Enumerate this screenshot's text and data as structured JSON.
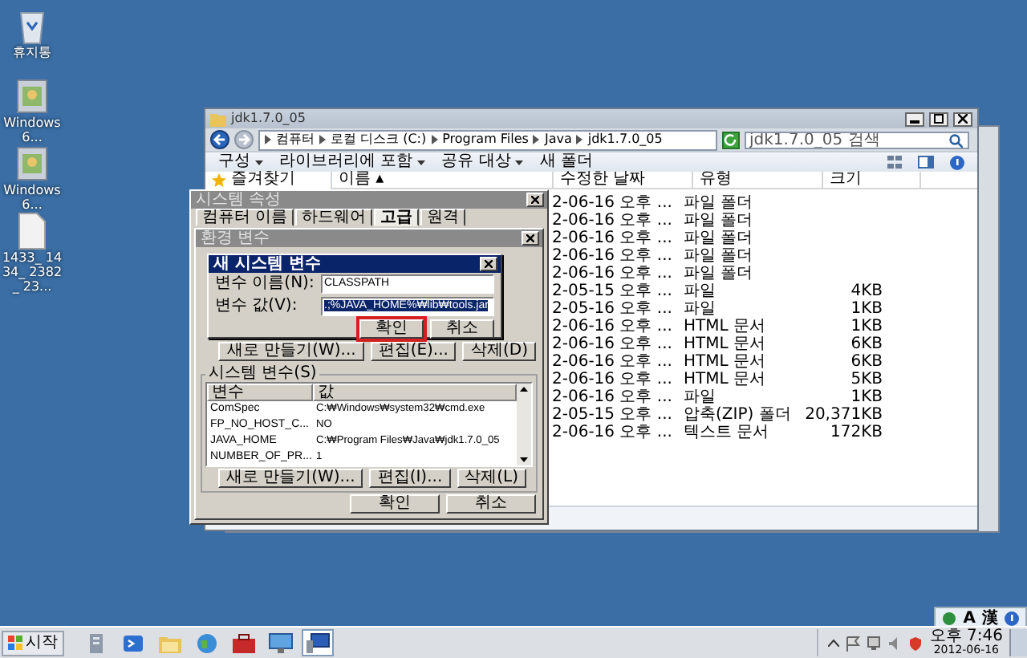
{
  "desktop_icons": [
    {
      "label": "휴지통",
      "kind": "recycle"
    },
    {
      "label": "Windows6...",
      "kind": "app"
    },
    {
      "label": "Windows6...",
      "kind": "app"
    },
    {
      "label": "1433_ 1434_ 2382_ 23...",
      "kind": "file"
    }
  ],
  "explorer": {
    "title": "jdk1.7.0_05",
    "breadcrumb": [
      "컴퓨터",
      "로컬 디스크 (C:)",
      "Program Files",
      "Java",
      "jdk1.7.0_05"
    ],
    "search": {
      "placeholder": "jdk1.7.0_05 검색"
    },
    "toolbar": [
      {
        "label": "구성",
        "dropdown": true
      },
      {
        "label": "라이브러리에 포함",
        "dropdown": true
      },
      {
        "label": "공유 대상",
        "dropdown": true
      },
      {
        "label": "새 폴더",
        "dropdown": false
      }
    ],
    "nav": [
      {
        "label": "즐겨찾기"
      }
    ],
    "columns": [
      "이름 ▴",
      "수정한 날짜",
      "유형",
      "크기"
    ],
    "rows": [
      {
        "modified": "2-06-16 오후 ...",
        "type": "파일 폴더"
      },
      {
        "modified": "2-06-16 오후 ...",
        "type": "파일 폴더"
      },
      {
        "modified": "2-06-16 오후 ...",
        "type": "파일 폴더"
      },
      {
        "modified": "2-06-16 오후 ...",
        "type": "파일 폴더"
      },
      {
        "modified": "2-06-16 오후 ...",
        "type": "파일 폴더"
      },
      {
        "modified": "2-05-15 오후 ...",
        "type": "파일",
        "size": "4KB"
      },
      {
        "modified": "2-05-16 오후 ...",
        "type": "파일",
        "size": "1KB"
      },
      {
        "modified": "2-06-16 오후 ...",
        "type": "HTML 문서",
        "size": "1KB"
      },
      {
        "modified": "2-06-16 오후 ...",
        "type": "HTML 문서",
        "size": "6KB"
      },
      {
        "modified": "2-06-16 오후 ...",
        "type": "HTML 문서",
        "size": "6KB"
      },
      {
        "modified": "2-06-16 오후 ...",
        "type": "HTML 문서",
        "size": "5KB"
      },
      {
        "modified": "2-06-16 오후 ...",
        "type": "파일",
        "size": "1KB"
      },
      {
        "modified": "2-05-15 오후 ...",
        "type": "압축(ZIP) 폴더",
        "size": "20,371KB"
      },
      {
        "modified": "2-06-16 오후 ...",
        "type": "텍스트 문서",
        "size": "172KB"
      }
    ]
  },
  "system_properties": {
    "title": "시스템 속성",
    "tabs": [
      {
        "label": "컴퓨터 이름",
        "selected": false
      },
      {
        "label": "하드웨어",
        "selected": false
      },
      {
        "label": "고급",
        "selected": true
      },
      {
        "label": "원격",
        "selected": false
      }
    ]
  },
  "environment_variables": {
    "title": "환경 변수",
    "user_buttons": [
      "새로 만들기(W)...",
      "편집(E)...",
      "삭제(D)"
    ],
    "system_group": "시스템 변수(S)",
    "columns": [
      "변수",
      "값"
    ],
    "system_rows": [
      {
        "name": "ComSpec",
        "value": "C:₩Windows₩system32₩cmd.exe",
        "selected": false
      },
      {
        "name": "FP_NO_HOST_C...",
        "value": "NO",
        "selected": false
      },
      {
        "name": "JAVA_HOME",
        "value": "C:₩Program Files₩Java₩jdk1.7.0_05",
        "selected": false
      },
      {
        "name": "NUMBER_OF_PR...",
        "value": "1",
        "selected": false
      }
    ],
    "system_buttons": [
      "새로 만들기(W)...",
      "편집(I)...",
      "삭제(L)"
    ],
    "buttons": [
      "확인",
      "취소"
    ]
  },
  "new_variable": {
    "title": "새 시스템 변수",
    "name_label": "변수 이름(N):",
    "name_value": "CLASSPATH",
    "value_label": "변수 값(V):",
    "value_value": ".;%JAVA_HOME%₩lib₩tools.jar",
    "value_selected": true,
    "buttons": [
      {
        "label": "확인",
        "highlighted": true
      },
      {
        "label": "취소",
        "highlighted": false
      }
    ]
  },
  "language_bar": [
    "A",
    "漢"
  ],
  "taskbar": {
    "start": "시작",
    "apps": [
      {
        "kind": "server",
        "selected": false
      },
      {
        "kind": "terminal",
        "selected": false
      },
      {
        "kind": "folder",
        "selected": false
      },
      {
        "kind": "globe",
        "selected": false
      },
      {
        "kind": "toolbox",
        "selected": false
      },
      {
        "kind": "monitor",
        "selected": false
      },
      {
        "kind": "system",
        "selected": true
      }
    ],
    "time": "오후 7:46",
    "date": "2012-06-16"
  }
}
